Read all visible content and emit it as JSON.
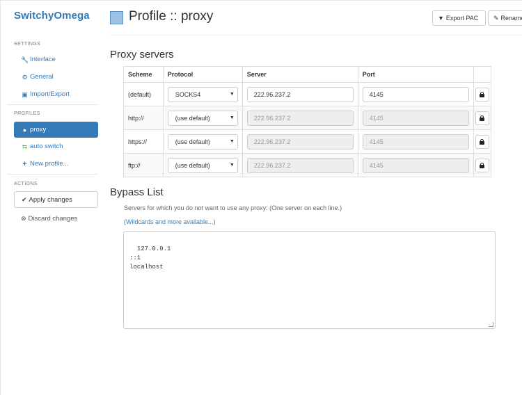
{
  "sidebar": {
    "app_title": "SwitchyOmega",
    "settings_label": "SETTINGS",
    "settings_items": [
      {
        "label": "Interface",
        "icon": "wrench-icon"
      },
      {
        "label": "General",
        "icon": "gear-icon"
      },
      {
        "label": "Import/Export",
        "icon": "floppy-icon"
      }
    ],
    "profiles_label": "PROFILES",
    "profile_items": [
      {
        "label": "proxy",
        "icon": "globe-icon"
      },
      {
        "label": "auto switch",
        "icon": "retweet-icon"
      },
      {
        "label": "New profile...",
        "icon": "plus-icon"
      }
    ],
    "actions_label": "ACTIONS",
    "apply_label": "Apply changes",
    "discard_label": "Discard changes"
  },
  "header": {
    "title": "Profile :: proxy",
    "profile_color": "#9cc3e6",
    "export_pac_label": "Export PAC",
    "rename_label": "Rename"
  },
  "proxy_servers": {
    "heading": "Proxy servers",
    "columns": [
      "Scheme",
      "Protocol",
      "Server",
      "Port",
      ""
    ],
    "rows": [
      {
        "scheme": "(default)",
        "protocol": "SOCKS4",
        "server": "222.96.237.2",
        "port": "4145",
        "disabled": false
      },
      {
        "scheme": "http://",
        "protocol": "(use default)",
        "server": "222.96.237.2",
        "port": "4145",
        "disabled": true
      },
      {
        "scheme": "https://",
        "protocol": "(use default)",
        "server": "222.96.237.2",
        "port": "4145",
        "disabled": true
      },
      {
        "scheme": "ftp://",
        "protocol": "(use default)",
        "server": "222.96.237.2",
        "port": "4145",
        "disabled": true
      }
    ]
  },
  "bypass": {
    "heading": "Bypass List",
    "help": "Servers for which you do not want to use any proxy: (One server on each line.)",
    "link": "(Wildcards and more available...)",
    "value": "127.0.0.1\n::1\nlocalhost"
  },
  "colors": {
    "accent": "#337ab7",
    "success": "#5cb85c"
  }
}
